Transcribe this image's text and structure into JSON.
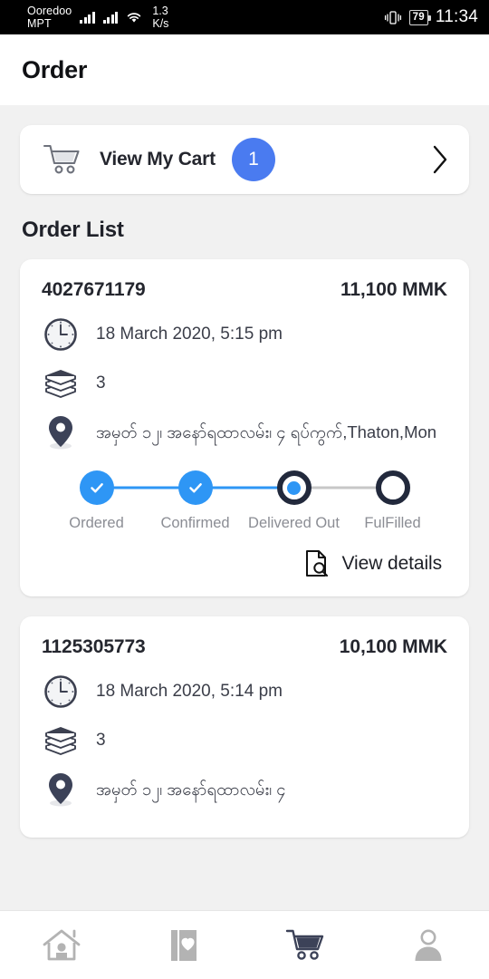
{
  "statusbar": {
    "carrier_primary": "Ooredoo",
    "carrier_secondary": "MPT",
    "net_speed_value": "1.3",
    "net_speed_unit": "K/s",
    "battery_level": "79",
    "clock": "11:34",
    "icons": [
      "signal-bars-icon",
      "signal-bars-icon",
      "wifi-icon",
      "vibrate-icon",
      "battery-icon"
    ]
  },
  "appbar": {
    "title": "Order"
  },
  "cart": {
    "icon": "shopping-cart-icon",
    "label": "View My Cart",
    "count": "1",
    "chevron": "chevron-right-icon",
    "badge_color": "#4a7bf0"
  },
  "order_list": {
    "title": "Order List",
    "orders": [
      {
        "id": "4027671179",
        "total": "11,100 MMK",
        "datetime": "18 March 2020, 5:15 pm",
        "item_count": "3",
        "address": "အမှတ် ၁၂၊ အနော်ရထာလမ်း၊ ၄ ရပ်ကွက်,Thaton,Mon",
        "steps": [
          {
            "label": "Ordered",
            "state": "done"
          },
          {
            "label": "Confirmed",
            "state": "done"
          },
          {
            "label": "Delivered Out",
            "state": "current"
          },
          {
            "label": "FulFilled",
            "state": "todo"
          }
        ],
        "details_label": "View details",
        "details_icon": "document-search-icon"
      },
      {
        "id": "1125305773",
        "total": "10,100 MMK",
        "datetime": "18 March 2020, 5:14 pm",
        "item_count": "3",
        "address": "အမှတ် ၁၂၊ အနော်ရထာလမ်း၊ ၄"
      }
    ]
  },
  "bottomnav": {
    "items": [
      {
        "name": "home",
        "icon": "home-icon",
        "active": false
      },
      {
        "name": "wishlist",
        "icon": "book-heart-icon",
        "active": false
      },
      {
        "name": "cart",
        "icon": "cart-icon",
        "active": true
      },
      {
        "name": "profile",
        "icon": "person-icon",
        "active": false
      }
    ],
    "active_color": "#3c4258",
    "inactive_color": "#b3b3b3"
  },
  "colors": {
    "accent_blue": "#2e96f5",
    "badge_blue": "#4a7bf0",
    "dark_navy": "#22293c",
    "page_bg": "#f1f1f1"
  }
}
